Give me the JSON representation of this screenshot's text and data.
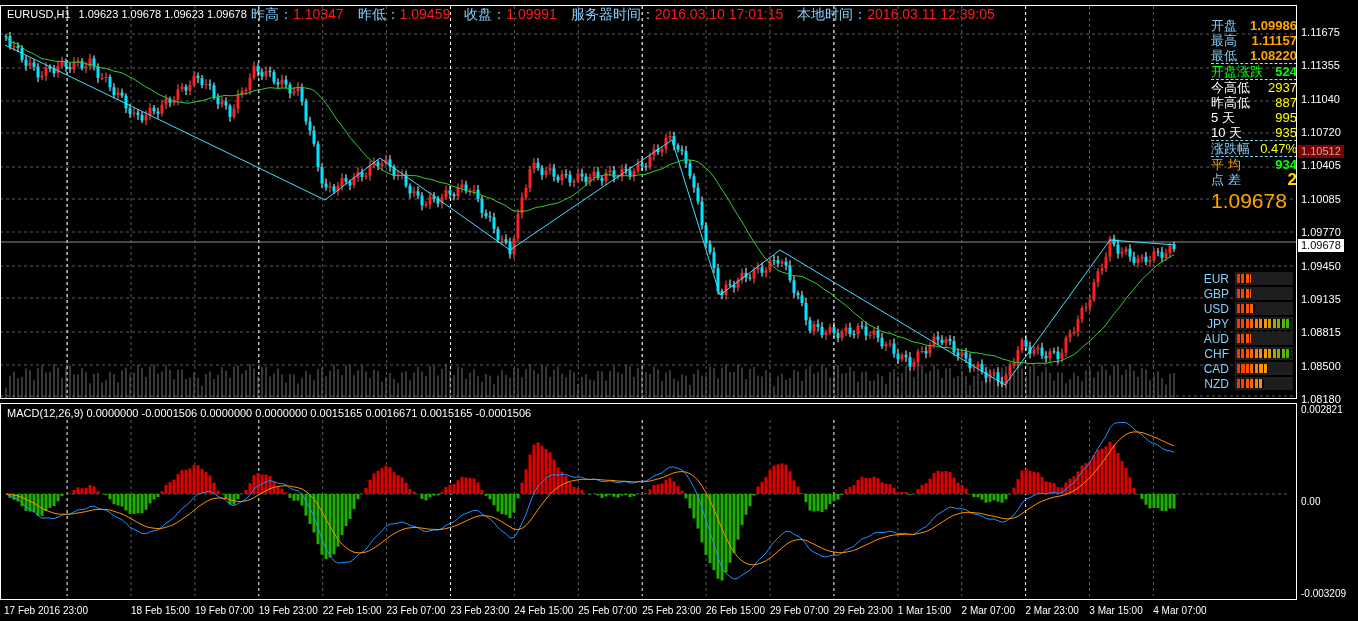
{
  "symbol_bar": {
    "symbol": "EURUSD,H1",
    "ohlc": "1.09623 1.09678 1.09623 1.09678"
  },
  "stats_bar": [
    {
      "label": "昨高：",
      "value": "1.10347"
    },
    {
      "label": "昨低：",
      "value": "1.09459"
    },
    {
      "label": "收盘：",
      "value": "1.09991"
    },
    {
      "label": "服务器时间：",
      "value": "2016.03.10 17:01:15"
    },
    {
      "label": "本地时间：",
      "value": "2016.03.11 12:39:05"
    }
  ],
  "info_panel": {
    "rows": [
      {
        "kind": "price",
        "label": "开盘",
        "value": "1.09986"
      },
      {
        "kind": "price",
        "label": "最高",
        "value": "1.11157"
      },
      {
        "kind": "price",
        "label": "最低",
        "value": "1.08220"
      },
      {
        "kind": "change",
        "label": "开盘涨跌",
        "value": "524"
      },
      {
        "kind": "range",
        "label": "今高低",
        "value": "2937"
      },
      {
        "kind": "range",
        "label": "昨高低",
        "value": "887"
      },
      {
        "kind": "range",
        "label": "5 天",
        "value": "995"
      },
      {
        "kind": "range",
        "label": "10 天",
        "value": "935"
      },
      {
        "kind": "pct",
        "label": "涨跌幅",
        "value": "0.47%"
      },
      {
        "kind": "avg",
        "label": "平 均",
        "value": "934"
      },
      {
        "kind": "spread",
        "label": "点 差",
        "value": "2"
      }
    ],
    "last_price": "1.09678"
  },
  "currency_strength": [
    {
      "name": "EUR",
      "level": 0.25
    },
    {
      "name": "GBP",
      "level": 0.25
    },
    {
      "name": "USD",
      "level": 0.3333
    },
    {
      "name": "JPY",
      "level": 1
    },
    {
      "name": "AUD",
      "level": 0.25
    },
    {
      "name": "CHF",
      "level": 1
    },
    {
      "name": "CAD",
      "level": 0.5833
    },
    {
      "name": "NZD",
      "level": 0.5
    }
  ],
  "price_axis": {
    "ticks": [
      "1.11675",
      "1.11355",
      "1.11040",
      "1.10720",
      "1.10405",
      "1.10085",
      "1.09770",
      "1.09450",
      "1.09135",
      "1.08815",
      "1.08500",
      "1.08180"
    ],
    "markers": [
      {
        "kind": "line",
        "label": "1.10512"
      },
      {
        "kind": "bid",
        "label": "1.09678"
      }
    ]
  },
  "macd": {
    "header": "MACD(12,26,9) 0.0000000 -0.0001506 0.0000000 0.0000000 0.0015165 0.0016671 0.0015165 -0.0001506",
    "ticks": [
      "0.002821",
      "0.00",
      "-0.003209"
    ]
  },
  "time_axis": {
    "labels": [
      "17 Feb 2016 23:00",
      "18 Feb 15:00",
      "19 Feb 07:00",
      "19 Feb 23:00",
      "22 Feb 15:00",
      "23 Feb 07:00",
      "23 Feb 23:00",
      "24 Feb 15:00",
      "25 Feb 07:00",
      "25 Feb 23:00",
      "26 Feb 15:00",
      "29 Feb 07:00",
      "29 Feb 23:00",
      "1 Mar 15:00",
      "2 Mar 07:00",
      "2 Mar 23:00",
      "3 Mar 15:00",
      "4 Mar 07:00"
    ]
  }
}
